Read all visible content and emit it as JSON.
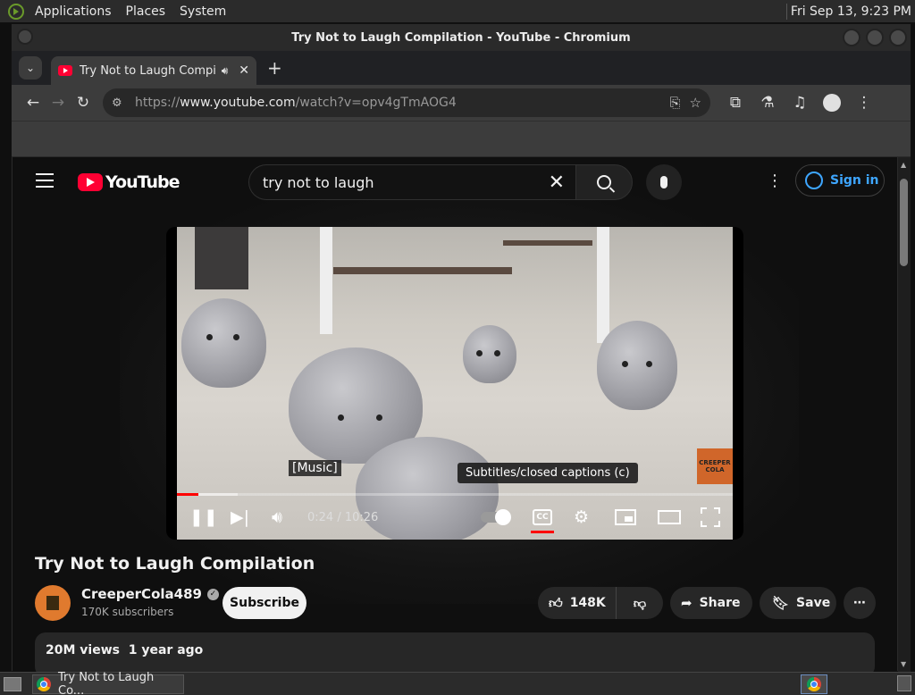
{
  "desktop": {
    "menus": [
      "Applications",
      "Places",
      "System"
    ],
    "clock": "Fri Sep 13,  9:23 PM"
  },
  "window": {
    "title": "Try Not to Laugh Compilation - YouTube - Chromium"
  },
  "browser": {
    "tab": {
      "title": "Try Not to Laugh Compil",
      "audio_icon": "speaker-icon",
      "close": "✕"
    },
    "new_tab": "+",
    "url": {
      "scheme": "https://",
      "host": "www.youtube.com",
      "path": "/watch?v=opv4gTmAOG4"
    }
  },
  "youtube": {
    "logo_text": "YouTube",
    "search_query": "try not to laugh",
    "signin_label": "Sign in",
    "accent": "#3ea6ff",
    "brand": "#ff0033"
  },
  "player": {
    "caption_text": "[Music]",
    "tooltip": "Subtitles/closed captions (c)",
    "time_current": "0:24",
    "time_separator": " / ",
    "time_total": "10:26",
    "played_fraction": 0.039,
    "loaded_fraction": 0.11,
    "watermark": "CREEPER COLA",
    "cc_label": "CC"
  },
  "video": {
    "title": "Try Not to Laugh Compilation",
    "channel_name": "CreeperCola489",
    "subscribers": "170K subscribers",
    "subscribe_label": "Subscribe",
    "likes": "148K",
    "share_label": "Share",
    "save_label": "Save",
    "views": "20M views",
    "age": "1 year ago"
  },
  "taskbar": {
    "task_label": "Try Not to Laugh Co..."
  }
}
